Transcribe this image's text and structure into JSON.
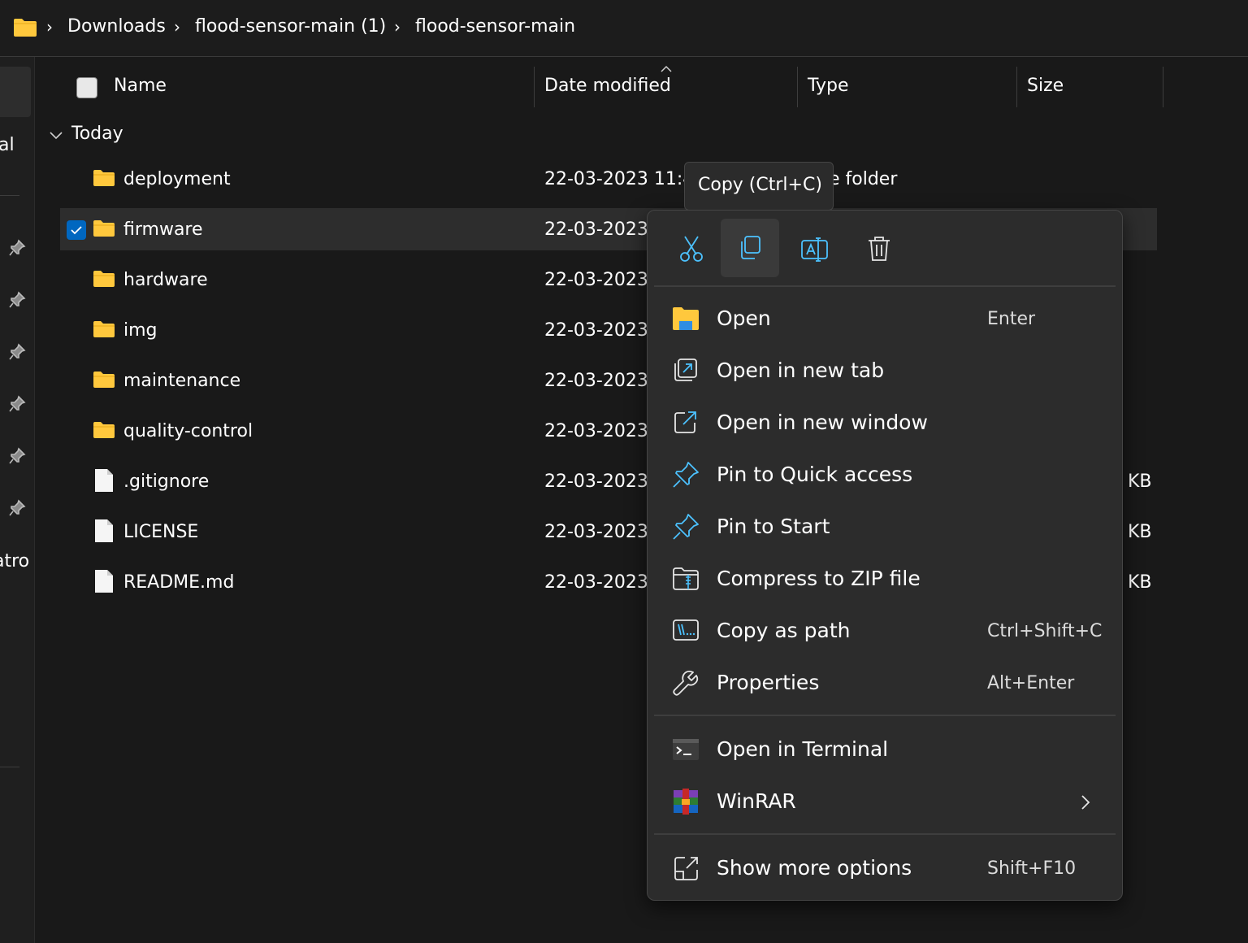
{
  "breadcrumb": [
    "Downloads",
    "flood-sensor-main (1)",
    "flood-sensor-main"
  ],
  "columns": {
    "name": "Name",
    "date": "Date modified",
    "type": "Type",
    "size": "Size"
  },
  "group": "Today",
  "sidebar_fragments": [
    "al",
    "atro"
  ],
  "files": [
    {
      "name": "deployment",
      "date": "22-03-2023 11:4",
      "kind": "folder",
      "type": "e folder",
      "size": "",
      "selected": false
    },
    {
      "name": "firmware",
      "date": "22-03-2023",
      "kind": "folder",
      "type": "",
      "size": "",
      "selected": true
    },
    {
      "name": "hardware",
      "date": "22-03-2023",
      "kind": "folder",
      "type": "",
      "size": "",
      "selected": false
    },
    {
      "name": "img",
      "date": "22-03-2023",
      "kind": "folder",
      "type": "",
      "size": "",
      "selected": false
    },
    {
      "name": "maintenance",
      "date": "22-03-2023",
      "kind": "folder",
      "type": "",
      "size": "",
      "selected": false
    },
    {
      "name": "quality-control",
      "date": "22-03-2023",
      "kind": "folder",
      "type": "",
      "size": "",
      "selected": false
    },
    {
      "name": ".gitignore",
      "date": "22-03-2023",
      "kind": "file",
      "type": "",
      "size": "KB",
      "selected": false
    },
    {
      "name": "LICENSE",
      "date": "22-03-2023",
      "kind": "file",
      "type": "",
      "size": "KB",
      "selected": false
    },
    {
      "name": "README.md",
      "date": "22-03-2023",
      "kind": "file",
      "type": "",
      "size": "KB",
      "selected": false
    }
  ],
  "tooltip": "Copy (Ctrl+C)",
  "context_menu": {
    "toolbar": [
      {
        "name": "cut",
        "icon": "scissors-icon"
      },
      {
        "name": "copy",
        "icon": "copy-icon",
        "active": true
      },
      {
        "name": "rename",
        "icon": "rename-icon"
      },
      {
        "name": "delete",
        "icon": "trash-icon"
      }
    ],
    "items": [
      {
        "label": "Open",
        "shortcut": "Enter",
        "icon": "folder-open-icon"
      },
      {
        "label": "Open in new tab",
        "shortcut": "",
        "icon": "new-tab-icon"
      },
      {
        "label": "Open in new window",
        "shortcut": "",
        "icon": "new-window-icon"
      },
      {
        "label": "Pin to Quick access",
        "shortcut": "",
        "icon": "pin-icon"
      },
      {
        "label": "Pin to Start",
        "shortcut": "",
        "icon": "pin-icon"
      },
      {
        "label": "Compress to ZIP file",
        "shortcut": "",
        "icon": "zip-icon"
      },
      {
        "label": "Copy as path",
        "shortcut": "Ctrl+Shift+C",
        "icon": "copy-path-icon"
      },
      {
        "label": "Properties",
        "shortcut": "Alt+Enter",
        "icon": "wrench-icon"
      },
      {
        "label": "Open in Terminal",
        "shortcut": "",
        "icon": "terminal-icon"
      },
      {
        "label": "WinRAR",
        "shortcut": "",
        "icon": "winrar-icon",
        "submenu": true
      },
      {
        "label": "Show more options",
        "shortcut": "Shift+F10",
        "icon": "more-options-icon"
      }
    ]
  },
  "colors": {
    "accent": "#0067c0",
    "folder": "#ffc83d",
    "icon_blue": "#4cc2ff",
    "background": "#191919",
    "menu": "#2c2c2c"
  }
}
